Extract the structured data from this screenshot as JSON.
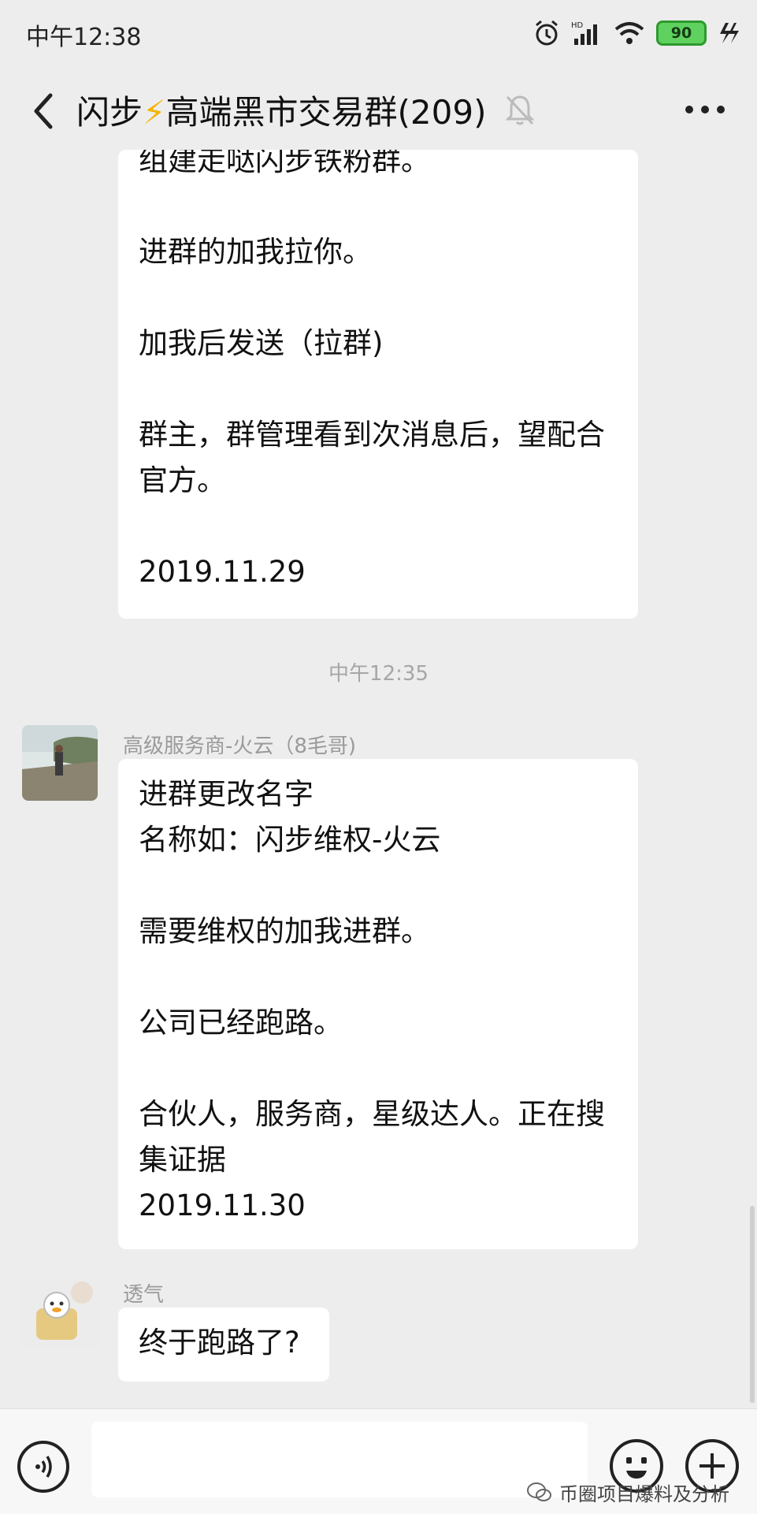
{
  "status_bar": {
    "time": "中午12:38",
    "battery": "90"
  },
  "header": {
    "title_prefix": "闪步",
    "title_bolt": "⚡",
    "title_rest": "高端黑市交易群(209)"
  },
  "messages": [
    {
      "lines": [
        "组建走哒闪步铁粉群。",
        "",
        "进群的加我拉你。",
        "",
        "加我后发送（拉群)",
        "",
        "群主，群管理看到次消息后，望配合",
        "官方。",
        "",
        "2019.11.29"
      ]
    }
  ],
  "timestamp": "中午12:35",
  "message2": {
    "sender": "高级服务商-火云（8毛哥)",
    "lines": [
      "进群更改名字",
      "名称如：闪步维权-火云",
      "",
      "需要维权的加我进群。",
      "",
      "公司已经跑路。",
      "",
      "合伙人，服务商，星级达人。正在搜",
      "集证据",
      "2019.11.30"
    ]
  },
  "message3": {
    "sender": "透气",
    "text": "终于跑路了?"
  },
  "watermark": "币圈项目爆料及分析",
  "colors": {
    "background": "#ededed",
    "bubble": "#ffffff",
    "battery": "#5fd15f",
    "bolt": "#f4b400"
  }
}
